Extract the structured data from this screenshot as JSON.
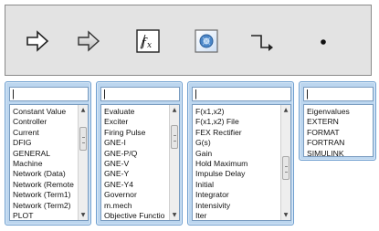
{
  "toolbar": {
    "tools": [
      {
        "name": "hollow-arrow-icon"
      },
      {
        "name": "gray-arrow-icon"
      },
      {
        "name": "function-block-icon"
      },
      {
        "name": "gear-block-icon"
      },
      {
        "name": "step-connector-icon"
      },
      {
        "name": "dot-node-icon"
      }
    ]
  },
  "panels": [
    {
      "search_value": "",
      "items": [
        "Constant Value",
        "Controller",
        "Current",
        "DFIG",
        "GENERAL",
        "Machine",
        "Network (Data)",
        "Network (Remote",
        "Network (Term1)",
        "Network (Term2)",
        "PLOT"
      ],
      "has_scrollbar": true
    },
    {
      "search_value": "",
      "items": [
        "Evaluate",
        "Exciter",
        "Firing Pulse",
        "GNE-I",
        "GNE-P/Q",
        "GNE-V",
        "GNE-Y",
        "GNE-Y4",
        "Governor",
        "m.mech",
        "Objective Functio"
      ],
      "has_scrollbar": true
    },
    {
      "search_value": "",
      "items": [
        "F(x1,x2)",
        "F(x1,x2) File",
        "FEX Rectifier",
        "G(s)",
        "Gain",
        "Hold Maximum",
        "Impulse Delay",
        "Initial",
        "Integrator",
        "Intensivity",
        "Iter"
      ],
      "has_scrollbar": true
    },
    {
      "search_value": "",
      "items": [
        "Eigenvalues",
        "EXTERN",
        "FORMAT",
        "FORTRAN",
        "SIMULINK"
      ],
      "has_scrollbar": false
    }
  ]
}
